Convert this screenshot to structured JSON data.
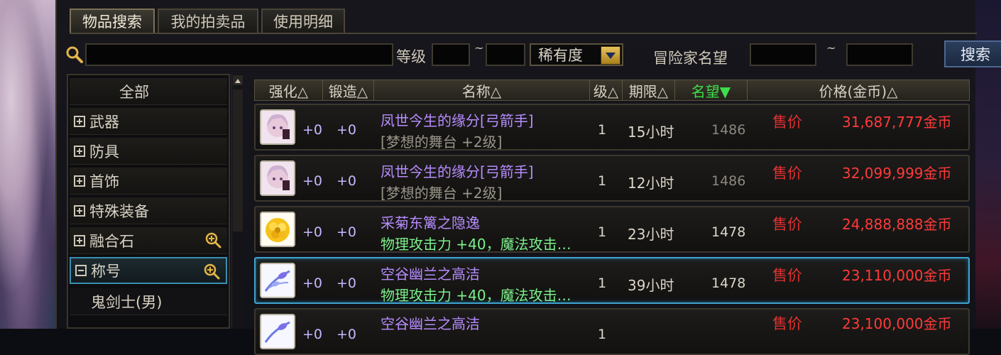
{
  "tabs": [
    {
      "label": "物品搜索",
      "active": true
    },
    {
      "label": "我的拍卖品",
      "active": false
    },
    {
      "label": "使用明细",
      "active": false
    }
  ],
  "search": {
    "keyword_value": "",
    "level_label": "等级",
    "range_sep": "~",
    "rarity_label": "稀有度",
    "fame_label": "冒险家名望",
    "button_label": "搜索"
  },
  "categories": [
    {
      "label": "全部",
      "expand": "none"
    },
    {
      "label": "武器",
      "expand": "plus"
    },
    {
      "label": "防具",
      "expand": "plus"
    },
    {
      "label": "首饰",
      "expand": "plus"
    },
    {
      "label": "特殊装备",
      "expand": "plus"
    },
    {
      "label": "融合石",
      "expand": "plus",
      "zoom": true
    },
    {
      "label": "称号",
      "expand": "minus",
      "zoom": true,
      "selected": true
    },
    {
      "label": "鬼剑士(男)",
      "expand": "none"
    }
  ],
  "columns": [
    "强化△",
    "锻造△",
    "名称△",
    "级△",
    "期限△",
    "名望▼",
    "价格(金币)△"
  ],
  "results": [
    {
      "enhance": "+0",
      "forge": "+0",
      "name": "凤世今生的缘分[弓箭手]",
      "sub": "[梦想的舞台 +2级]",
      "sub_type": "gray",
      "level": "1",
      "period": "15小时",
      "fame": "1486",
      "fame_dim": true,
      "sell": "售价",
      "price": "31,687,777金币",
      "icon": "portrait-icon"
    },
    {
      "enhance": "+0",
      "forge": "+0",
      "name": "凤世今生的缘分[弓箭手]",
      "sub": "[梦想的舞台 +2级]",
      "sub_type": "gray",
      "level": "1",
      "period": "12小时",
      "fame": "1486",
      "fame_dim": true,
      "sell": "售价",
      "price": "32,099,999金币",
      "icon": "portrait-icon"
    },
    {
      "enhance": "+0",
      "forge": "+0",
      "name": "采菊东篱之隐逸",
      "sub": "物理攻击力 +40，魔法攻击…",
      "sub_type": "green",
      "level": "1",
      "period": "23小时",
      "fame": "1478",
      "fame_dim": false,
      "sell": "售价",
      "price": "24,888,888金币",
      "icon": "chrysanthemum-icon"
    },
    {
      "enhance": "+0",
      "forge": "+0",
      "name": "空谷幽兰之高洁",
      "sub": "物理攻击力 +40，魔法攻击…",
      "sub_type": "green",
      "level": "1",
      "period": "39小时",
      "fame": "1478",
      "fame_dim": false,
      "sell": "售价",
      "price": "23,110,000金币",
      "icon": "orchid-icon",
      "selected": true
    },
    {
      "enhance": "+0",
      "forge": "+0",
      "name": "空谷幽兰之高洁",
      "sub": "",
      "sub_type": "green",
      "level": "1",
      "period": "",
      "fame": "",
      "fame_dim": false,
      "sell": "售价",
      "price": "23,100,000金币",
      "icon": "orchid-icon"
    }
  ],
  "colors": {
    "price": "#ff3a3a",
    "name": "#b78cff",
    "stat": "#7cf08a",
    "highlight": "#3fa3cf"
  }
}
